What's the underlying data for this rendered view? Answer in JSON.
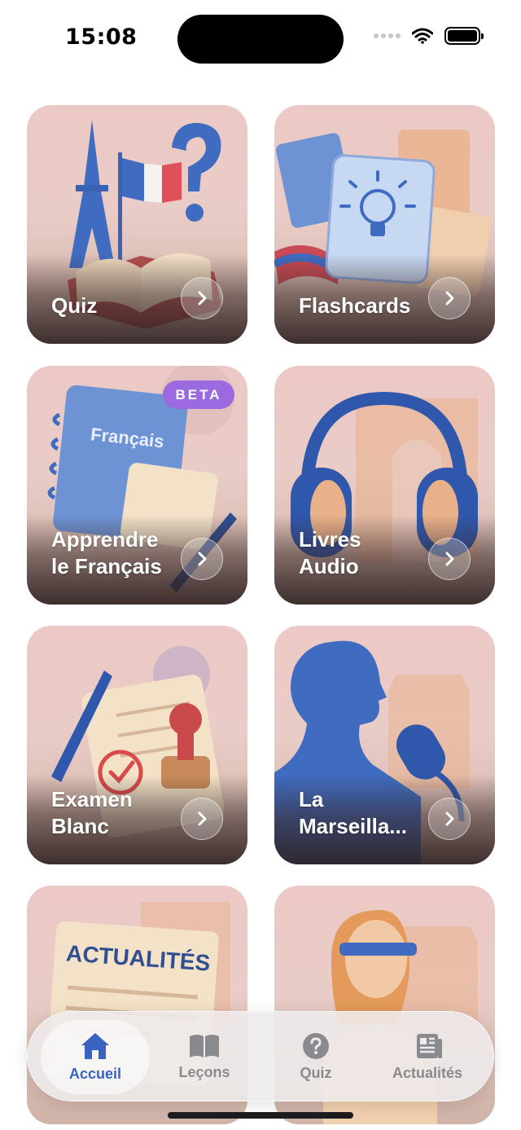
{
  "status_bar": {
    "time": "15:08"
  },
  "cards": [
    {
      "title": "Quiz",
      "icon": "eiffel-flag-question-icon"
    },
    {
      "title": "Flashcards",
      "icon": "lightbulb-card-icon"
    },
    {
      "title": "Apprendre\nle Français",
      "icon": "notebook-icon",
      "badge": "BETA",
      "notebook_text": "Français"
    },
    {
      "title": "Livres\nAudio",
      "icon": "headphones-icon"
    },
    {
      "title": "Examen\nBlanc",
      "icon": "exam-stamp-icon"
    },
    {
      "title": "La\nMarseilla...",
      "icon": "singer-microphone-icon"
    },
    {
      "title": "",
      "icon": "newspaper-icon",
      "newspaper_text": "ACTUALITÉS"
    },
    {
      "title": "",
      "icon": "marianne-icon"
    }
  ],
  "tabbar": {
    "tabs": [
      {
        "label": "Accueil",
        "icon": "home-icon",
        "active": true
      },
      {
        "label": "Leçons",
        "icon": "book-icon",
        "active": false
      },
      {
        "label": "Quiz",
        "icon": "question-circle-icon",
        "active": false
      },
      {
        "label": "Actualités",
        "icon": "newspaper-icon",
        "active": false
      }
    ]
  },
  "colors": {
    "accent": "#3a62bf",
    "badge": "#9b6ae0",
    "card_bg": "#ecc9c6"
  }
}
